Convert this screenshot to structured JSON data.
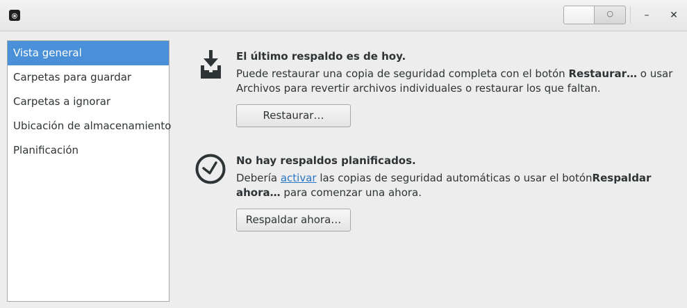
{
  "header": {
    "app_icon": "deja-dup-icon",
    "switch_state": "○",
    "minimize_glyph": "–",
    "close_glyph": "✕"
  },
  "sidebar": {
    "items": [
      {
        "label": "Vista general",
        "active": true
      },
      {
        "label": "Carpetas para guardar",
        "active": false
      },
      {
        "label": "Carpetas a ignorar",
        "active": false
      },
      {
        "label": "Ubicación de almacenamiento",
        "active": false
      },
      {
        "label": "Planificación",
        "active": false
      }
    ]
  },
  "restore": {
    "icon": "download-to-tray-icon",
    "title": "El último respaldo es de hoy.",
    "body_part1": "Puede restaurar una copia de seguridad completa con el botón ",
    "body_bold": "Restaurar…",
    "body_part2": " o usar Archivos para revertir archivos individuales o restaurar los que faltan.",
    "button_label": "Restaurar…"
  },
  "schedule": {
    "icon": "clock-icon",
    "title": "No hay respaldos planificados.",
    "body_part1": "Debería ",
    "body_link": "activar",
    "body_part2": " las copias de seguridad automáticas o usar el botón",
    "body_bold": "Respaldar ahora…",
    "body_part3": " para comenzar una ahora.",
    "button_label": "Respaldar ahora…"
  },
  "colors": {
    "accent": "#4a90d9",
    "link": "#2a76c6",
    "background": "#ededed"
  }
}
